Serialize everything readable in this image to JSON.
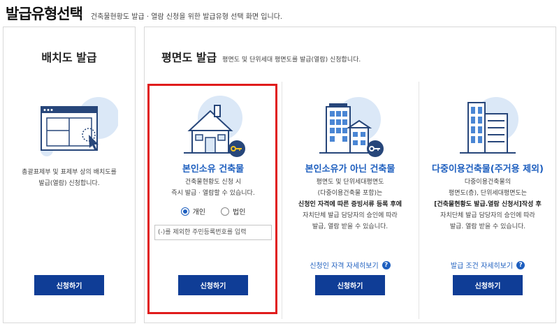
{
  "header": {
    "title": "발급유형선택",
    "subtitle": "건축물현황도 발급 · 열람 신청을 위한 발급유형 선택 화면 입니다."
  },
  "left_panel": {
    "title": "배치도 발급",
    "description": "총괄표제부 및 표제부 상의 배치도를\n발급(열람) 신청합니다.",
    "apply_label": "신청하기"
  },
  "right_panel": {
    "title": "평면도 발급",
    "subtitle": "평면도 및 단위세대 평면도를 발급(열람) 신청합니다."
  },
  "cards": [
    {
      "title": "본인소유 건축물",
      "desc_1": "건축물현황도 신청 시",
      "desc_2": "즉시 발급 · 열람할 수 있습니다.",
      "radio_personal": "개인",
      "radio_corporate": "법인",
      "selected": "개인",
      "input_placeholder": "(-)를 제외한 주민등록번호를 입력",
      "input_value": "",
      "apply_label": "신청하기"
    },
    {
      "title": "본인소유가 아닌 건축물",
      "desc_1": "평면도 및 단위세대평면도",
      "desc_2": "(다중이용건축물 포함)는",
      "desc_3": "신청인 자격에 따른 증빙서류 등록 후에",
      "desc_4": "자치단체 발급 담당자의 승인에 따라",
      "desc_5": "발급, 열람 받을 수 있습니다.",
      "link": "신청인 자격 자세히보기",
      "apply_label": "신청하기"
    },
    {
      "title": "다중이용건축물(주거용 제외)",
      "desc_1": "다중이용건축물의",
      "desc_2": "평면도(층), 단위세대평면도는",
      "desc_3": "[건축물현황도 발급.열람 신청서]작성 후",
      "desc_4": "자치단체 발급 담당자의 승인에 따라",
      "desc_5": "발급. 열람 받을 수 있습니다.",
      "link": "발급 조건 자세히보기",
      "apply_label": "신청하기"
    }
  ],
  "help_icon_glyph": "?",
  "colors": {
    "accent_blue": "#1e5fbf",
    "button_navy": "#0f3d96",
    "highlight_red": "#e01c1c",
    "icon_light_blue": "#dbe8f7"
  },
  "icons": [
    "site-plan-window-icon",
    "house-key-icon",
    "building-key-icon",
    "office-building-icon",
    "help-icon"
  ]
}
